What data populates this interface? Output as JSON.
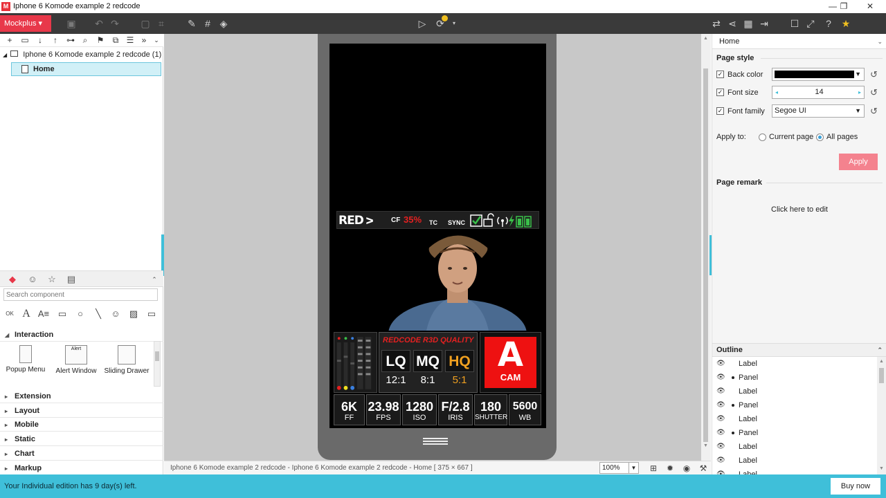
{
  "window": {
    "title": "Iphone 6 Komode example 2 redcode",
    "app_icon": "M",
    "minimize": "—",
    "restore": "❐",
    "close": "✕"
  },
  "toolbar": {
    "mockplus_label": "Mockplus ▾",
    "icons": [
      "save-icon",
      "undo-icon",
      "redo-icon",
      "frame-icon",
      "crop-icon",
      "brush-icon",
      "grid-icon",
      "paint-bucket-icon",
      "play-icon",
      "sync-icon",
      "swap-icon",
      "share-icon",
      "qr-code-icon",
      "export-icon",
      "window-icon",
      "fullscreen-icon",
      "help-icon",
      "upgrade-icon"
    ]
  },
  "pages": {
    "root_label": "Iphone 6 Komode example 2 redcode (1)",
    "home_label": "Home"
  },
  "components": {
    "search_placeholder": "Search component",
    "sections": {
      "interaction": "Interaction",
      "extension": "Extension",
      "layout": "Layout",
      "mobile": "Mobile",
      "static": "Static",
      "chart": "Chart",
      "markup": "Markup"
    },
    "items": [
      "Popup Menu",
      "Alert Window",
      "Sliding Drawer"
    ],
    "alert_pic_label": "Alert"
  },
  "redcode": {
    "logo": "RED",
    "cf": "CF",
    "cf_percent": "35%",
    "tc": "TC",
    "sync": "SYNC",
    "quality_title": "REDCODE R3D QUALITY",
    "qualities": [
      {
        "name": "LQ",
        "ratio": "12:1"
      },
      {
        "name": "MQ",
        "ratio": "8:1"
      },
      {
        "name": "HQ",
        "ratio": "5:1"
      }
    ],
    "cam_letter": "A",
    "cam_label": "CAM",
    "stats": [
      {
        "value": "6K",
        "label": "FF"
      },
      {
        "value": "23.98",
        "label": "FPS"
      },
      {
        "value": "1280",
        "label": "ISO"
      },
      {
        "value": "F/2.8",
        "label": "IRIS"
      },
      {
        "value": "180",
        "label": "SHUTTER"
      },
      {
        "value": "5600",
        "label": "WB"
      }
    ],
    "colors": {
      "red": "#e52020",
      "hq": "#f0a020",
      "green": "#3ac04a"
    }
  },
  "canvas_status": {
    "path": "Iphone 6 Komode example 2 redcode - Iphone 6 Komode example 2 redcode - Home [ 375 × 667 ]",
    "zoom": "100%"
  },
  "right_panel": {
    "header": "Home",
    "page_style": "Page style",
    "back_color_label": "Back color",
    "back_color_value": "#000000",
    "font_size_label": "Font size",
    "font_size_value": "14",
    "font_family_label": "Font family",
    "font_family_value": "Segoe UI",
    "apply_to_label": "Apply to:",
    "current_page": "Current page",
    "all_pages": "All pages",
    "apply_button": "Apply",
    "page_remark": "Page remark",
    "remark_edit": "Click here to edit"
  },
  "outline": {
    "title": "Outline",
    "items": [
      {
        "label": "Label",
        "dot": false
      },
      {
        "label": "Panel",
        "dot": true
      },
      {
        "label": "Label",
        "dot": false
      },
      {
        "label": "Panel",
        "dot": true
      },
      {
        "label": "Label",
        "dot": false
      },
      {
        "label": "Panel",
        "dot": true
      },
      {
        "label": "Label",
        "dot": false
      },
      {
        "label": "Label",
        "dot": false
      },
      {
        "label": "Label",
        "dot": false
      }
    ]
  },
  "bottom": {
    "trial_text": "Your Individual edition has 9 day(s) left.",
    "buy_button": "Buy now"
  }
}
